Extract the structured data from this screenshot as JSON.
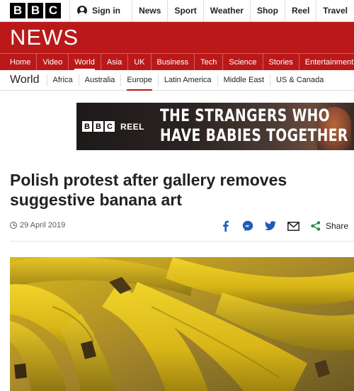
{
  "topbar": {
    "logo_letters": [
      "B",
      "B",
      "C"
    ],
    "signin_label": "Sign in",
    "nav": [
      "News",
      "Sport",
      "Weather",
      "Shop",
      "Reel",
      "Travel"
    ]
  },
  "news": {
    "wordmark": "NEWS"
  },
  "section_nav": {
    "items": [
      "Home",
      "Video",
      "World",
      "Asia",
      "UK",
      "Business",
      "Tech",
      "Science",
      "Stories",
      "Entertainment"
    ],
    "active": "World"
  },
  "sub_nav": {
    "title": "World",
    "items": [
      "Africa",
      "Australia",
      "Europe",
      "Latin America",
      "Middle East",
      "US & Canada"
    ],
    "active": "Europe"
  },
  "promo": {
    "brand_letters": [
      "B",
      "B",
      "C"
    ],
    "brand_label": "REEL",
    "headline_line1": "THE STRANGERS WHO",
    "headline_line2": "HAVE BABIES TOGETHER"
  },
  "article": {
    "headline": "Polish protest after gallery removes suggestive banana art",
    "date": "29 April 2019",
    "share_label": "Share"
  },
  "icons": {
    "facebook": "facebook-icon",
    "messenger": "messenger-icon",
    "twitter": "twitter-icon",
    "email": "email-icon",
    "share": "share-icon",
    "clock": "clock-icon"
  },
  "colors": {
    "brand_red": "#bb1919",
    "share_blue": "#1e5bb8",
    "share_green": "#1a8a3a"
  }
}
